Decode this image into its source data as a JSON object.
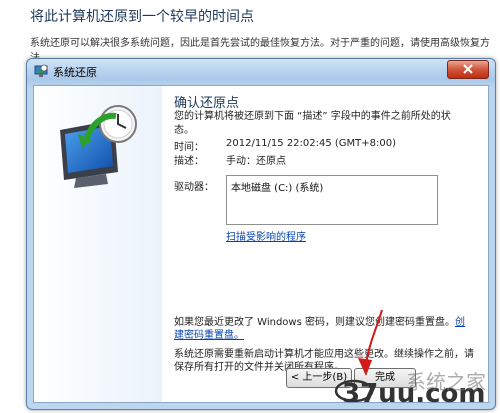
{
  "page": {
    "heading": "将此计算机还原到一个较早的时间点",
    "description": "系统还原可以解决很多系统问题，因此是首先尝试的最佳恢复方法。对于严重的问题，请使用高级恢复方法。"
  },
  "dialog": {
    "title": "系统还原",
    "confirm_heading": "确认还原点",
    "intro": "您的计算机将被还原到下面 “描述” 字段中的事件之前所处的状态。",
    "time_label": "时间：",
    "time_value": "2012/11/15 22:02:45 (GMT+8:00)",
    "desc_label": "描述：",
    "desc_value": "手动：还原点",
    "drives_label": "驱动器：",
    "drives": [
      "本地磁盘 (C:) (系统)"
    ],
    "scan_link": "扫描受影响的程序",
    "password_note": "如果您最近更改了 Windows 密码，则建议您创建密码重置盘。",
    "password_link": "创建密码重置盘。",
    "restart_note": "系统还原需要重新启动计算机才能应用这些更改。继续操作之前，请保存所有打开的文件并关闭所有程序。",
    "back_button": "< 上一步(B)",
    "finish_button": "完成"
  },
  "watermark": {
    "logo": "37uu.com",
    "brand": "系统之家"
  },
  "colors": {
    "heading": "#1e395b",
    "link": "#0645ad",
    "arrow": "#d11a1a"
  }
}
